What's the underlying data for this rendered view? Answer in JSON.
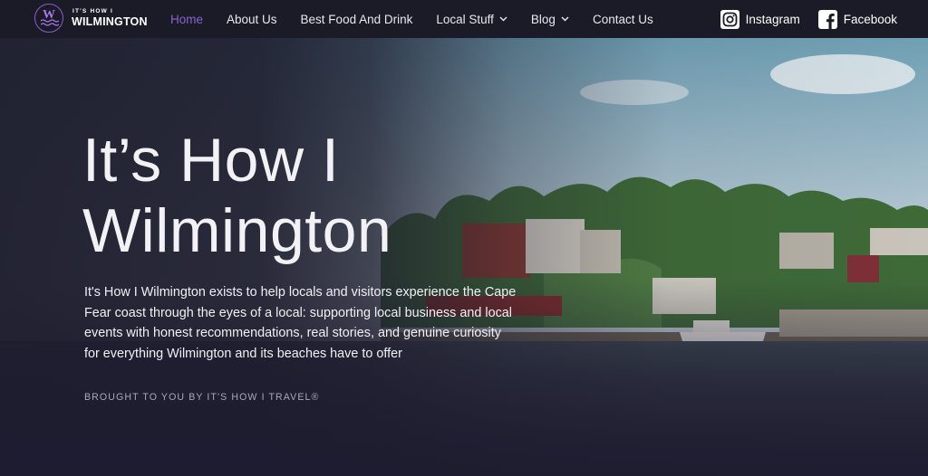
{
  "logo": {
    "small_text": "IT'S HOW I",
    "big_text": "WILMINGTON",
    "mark_letter": "W"
  },
  "nav": {
    "items": [
      {
        "label": "Home",
        "active": true,
        "has_dropdown": false
      },
      {
        "label": "About Us",
        "active": false,
        "has_dropdown": false
      },
      {
        "label": "Best Food And Drink",
        "active": false,
        "has_dropdown": false
      },
      {
        "label": "Local Stuff",
        "active": false,
        "has_dropdown": true
      },
      {
        "label": "Blog",
        "active": false,
        "has_dropdown": true
      },
      {
        "label": "Contact Us",
        "active": false,
        "has_dropdown": false
      }
    ]
  },
  "social": {
    "instagram_label": "Instagram",
    "facebook_label": "Facebook"
  },
  "hero": {
    "title_line1": "It’s How I",
    "title_line2": "Wilmington",
    "description": "It's How I Wilmington exists to help locals and visitors experience the Cape Fear coast through the eyes of a local: supporting local business and local events with honest recommendations, real stories, and genuine curiosity for everything Wilmington and its beaches have to offer",
    "credit": "BROUGHT TO YOU BY IT'S HOW I TRAVEL®"
  },
  "colors": {
    "header_bg": "#1a1b26",
    "accent": "#8a63d2",
    "text": "#f2f2f6",
    "overlay": "#1e1e2e"
  }
}
